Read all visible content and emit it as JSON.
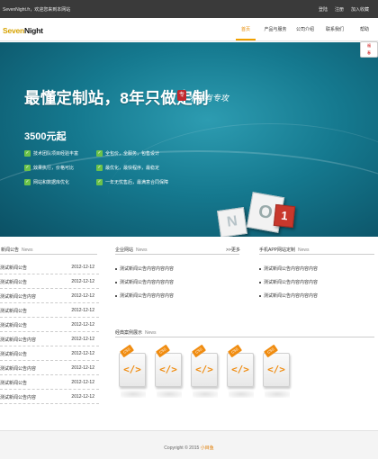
{
  "topbar": {
    "welcome": "SevenNight.fr，欢迎您来到本网站",
    "links": [
      "登陆",
      "注册",
      "加入收藏"
    ]
  },
  "logo": {
    "part1": "Seven",
    "part2": "Night"
  },
  "nav": {
    "items": [
      {
        "label": "首页",
        "active": true
      },
      {
        "label": "产品与服务",
        "active": false
      },
      {
        "label": "公司介绍",
        "active": false
      },
      {
        "label": "联系我们",
        "active": false
      },
      {
        "label": "帮助",
        "active": false
      }
    ]
  },
  "banner": {
    "headline": "最懂定制站，8年只做定制",
    "badge": "专",
    "slogan": "术业有专攻",
    "price": "3500元起",
    "features": [
      "技术团队项目经验丰富",
      "全包价，全服务，包售设计",
      "效果执行，价格可比",
      "最优化，最快程序，最稳定",
      "网站和数据库优化",
      "一年无忧售后，最满意合同保障"
    ],
    "cube_a": "N",
    "cube_b": "O",
    "cube_c": "1",
    "slides": 2,
    "active_slide": 0
  },
  "news": {
    "title": "新闻公告",
    "title_en": "News",
    "items": [
      {
        "title": "测试新闻公告",
        "date": "2012-12-12"
      },
      {
        "title": "测试新闻公告",
        "date": "2012-12-12"
      },
      {
        "title": "测试新闻公告内容",
        "date": "2012-12-12"
      },
      {
        "title": "测试新闻公告",
        "date": "2012-12-12"
      },
      {
        "title": "测试新闻公告",
        "date": "2012-12-12"
      },
      {
        "title": "测试新闻公告内容",
        "date": "2012-12-12"
      },
      {
        "title": "测试新闻公告",
        "date": "2012-12-12"
      },
      {
        "title": "测试新闻公告内容",
        "date": "2012-12-12"
      },
      {
        "title": "测试新闻公告",
        "date": "2012-12-12"
      },
      {
        "title": "测试新闻公告内容",
        "date": "2012-12-12"
      }
    ]
  },
  "corp": {
    "title": "企业网站",
    "title_en": "News",
    "more": ">>更多",
    "items": [
      "测试新闻公告内容内容内容",
      "测试新闻公告内容内容内容",
      "测试新闻公告内容内容内容"
    ]
  },
  "mobile": {
    "title": "手机APP网站定制",
    "title_en": "News",
    "items": [
      "测试新闻公告内容内容内容",
      "测试新闻公告内容内容内容",
      "测试新闻公告内容内容内容"
    ]
  },
  "cases": {
    "title": "经典案例展示",
    "title_en": "News",
    "items": [
      {
        "tag": "CSS",
        "code": "</>"
      },
      {
        "tag": "CSS",
        "code": "</>"
      },
      {
        "tag": "CSS",
        "code": "</>"
      },
      {
        "tag": "CSS",
        "code": "</>"
      },
      {
        "tag": "CSS",
        "code": "</>"
      }
    ]
  },
  "footer": {
    "text": "Copyright © 2015 ",
    "link": "小目鱼"
  },
  "colors": {
    "accent": "#f0a000",
    "topbar": "#3a3a3a",
    "banner": "#15798f",
    "check": "#6cc24a"
  }
}
